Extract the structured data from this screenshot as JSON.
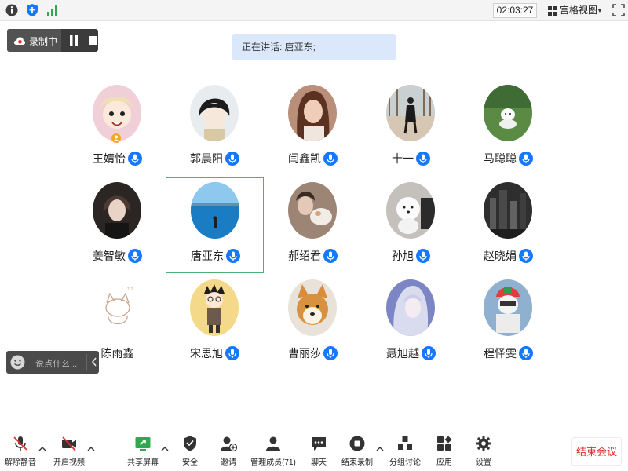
{
  "topbar": {
    "timer": "02:03:27",
    "view_label": "宫格视图",
    "icons": [
      "info-icon",
      "shield-icon",
      "signal-icon",
      "grid-icon",
      "fullscreen-icon"
    ]
  },
  "recording": {
    "label": "录制中",
    "icons": [
      "cloud-record-icon",
      "pause-icon",
      "stop-icon"
    ]
  },
  "speaking": {
    "text": "正在讲话: 唐亚东;"
  },
  "participants": [
    {
      "name": "王婧怡",
      "mic": true,
      "badge": true
    },
    {
      "name": "郭晨阳",
      "mic": true
    },
    {
      "name": "闫鑫凯",
      "mic": true
    },
    {
      "name": "十一",
      "mic": true
    },
    {
      "name": "马聪聪",
      "mic": true
    },
    {
      "name": "姜智敏",
      "mic": true
    },
    {
      "name": "唐亚东",
      "mic": true,
      "active": true
    },
    {
      "name": "郝绍君",
      "mic": true
    },
    {
      "name": "孙旭",
      "mic": true
    },
    {
      "name": "赵晓娟",
      "mic": true
    },
    {
      "name": "陈雨鑫",
      "mic": false
    },
    {
      "name": "宋思旭",
      "mic": true
    },
    {
      "name": "曹丽莎",
      "mic": true
    },
    {
      "name": "聂旭越",
      "mic": true
    },
    {
      "name": "程怿雯",
      "mic": true
    }
  ],
  "chat": {
    "placeholder": "说点什么..."
  },
  "toolbar": {
    "unmute": "解除静音",
    "start_video": "开启视频",
    "share_screen": "共享屏幕",
    "security": "安全",
    "invite": "邀请",
    "manage_members": "管理成员(71)",
    "chat": "聊天",
    "end_recording": "结束录制",
    "breakout": "分组讨论",
    "apps": "应用",
    "settings": "设置",
    "end_meeting": "结束会议"
  },
  "colors": {
    "accent": "#1677ff",
    "end": "#e0302e",
    "active_border": "#4db07a"
  }
}
